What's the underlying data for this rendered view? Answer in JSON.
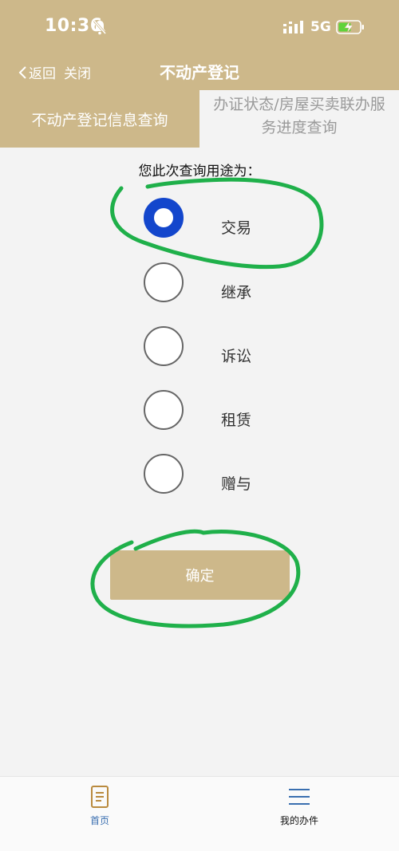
{
  "status_bar": {
    "time": "10:36",
    "network": "5G",
    "battery_fill": 0.6
  },
  "nav": {
    "back_label": "返回",
    "close_label": "关闭",
    "title": "不动产登记"
  },
  "tabs": {
    "active": "不动产登记信息查询",
    "inactive_line1": "办证状态/房屋买卖联办服",
    "inactive_line2": "务进度查询"
  },
  "form": {
    "question": "您此次查询用途为：",
    "options": [
      {
        "label": "交易",
        "selected": true
      },
      {
        "label": "继承",
        "selected": false
      },
      {
        "label": "诉讼",
        "selected": false
      },
      {
        "label": "租赁",
        "selected": false
      },
      {
        "label": "赠与",
        "selected": false
      }
    ],
    "confirm_label": "确定"
  },
  "bottom_tabs": [
    {
      "label": "首页",
      "icon": "document-icon",
      "color": "#b98a3e"
    },
    {
      "label": "我的办件",
      "icon": "menu-icon",
      "color": "#3a6fb0"
    }
  ],
  "colors": {
    "accent": "#cdb88a",
    "radio_selected": "#1346cc",
    "annotation": "#1fb04a"
  }
}
